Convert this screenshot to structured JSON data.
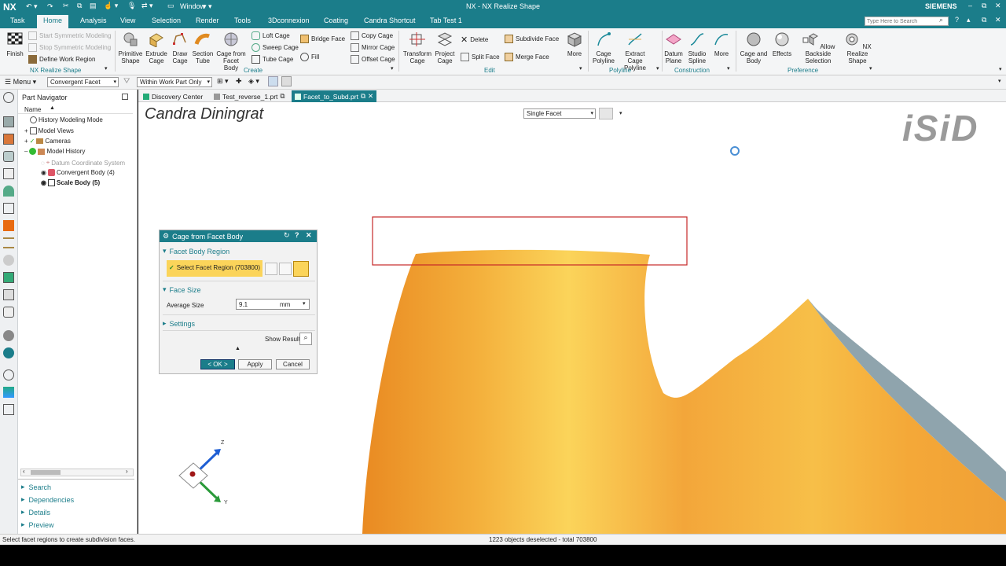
{
  "titlebar": {
    "app": "NX",
    "window_menu": "Window",
    "title": "NX - NX Realize Shape",
    "brand": "SIEMENS",
    "search_placeholder": "Type Here to Search"
  },
  "menu_tabs": [
    "Task",
    "Home",
    "Analysis",
    "View",
    "Selection",
    "Render",
    "Tools",
    "3Dconnexion",
    "Coating",
    "Candra Shortcut",
    "Tab Test 1"
  ],
  "ribbon": {
    "finish": "Finish",
    "realize_small": [
      "Start Symmetric Modeling",
      "Stop Symmetric Modeling",
      "Define Work Region"
    ],
    "realize_group": "NX Realize Shape",
    "create_big": [
      "Primitive Shape",
      "Extrude Cage",
      "Draw Cage",
      "Section Tube",
      "Cage from Facet Body"
    ],
    "create_small_a": [
      "Loft Cage",
      "Sweep Cage",
      "Tube Cage"
    ],
    "create_small_b": [
      "Bridge Face",
      "Fill"
    ],
    "create_small_c": [
      "Copy Cage",
      "Mirror Cage",
      "Offset Cage"
    ],
    "create_group": "Create",
    "edit_big": [
      "Transform Cage",
      "Project Cage"
    ],
    "edit_small_a": [
      "Delete",
      "Split Face"
    ],
    "edit_small_b": [
      "Subdivide Face",
      "Merge Face"
    ],
    "edit_more": "More",
    "edit_group": "Edit",
    "polyline_big": [
      "Cage Polyline",
      "Extract Cage Polyline"
    ],
    "polyline_group": "Polyline",
    "construction_big": [
      "Datum Plane",
      "Studio Spline",
      "More"
    ],
    "construction_group": "Construction",
    "preference_big": [
      "Cage and Body",
      "Effects",
      "Allow Backside Selection",
      "NX Realize Shape"
    ],
    "preference_group": "Preference"
  },
  "toolbar2": {
    "menu": "Menu",
    "filter": "Convergent Facet",
    "scope": "Within Work Part Only"
  },
  "navigator": {
    "title": "Part Navigator",
    "column": "Name",
    "items": [
      "History Modeling Mode",
      "Model Views",
      "Cameras",
      "Model History",
      "Datum Coordinate System",
      "Convergent Body (4)",
      "Scale Body (5)"
    ],
    "sections": [
      "Search",
      "Dependencies",
      "Details",
      "Preview"
    ]
  },
  "doc_tabs": [
    "Discovery Center",
    "Test_reverse_1.prt",
    "Facet_to_Subd.prt"
  ],
  "viewport": {
    "watermark": "Candra Diningrat",
    "logo": "iSiD",
    "facet_select": "Single Facet",
    "axis_z": "Z",
    "axis_y": "Y"
  },
  "dialog": {
    "title": "Cage from Facet Body",
    "sec1": "Facet Body Region",
    "select_label": "Select Facet Region (703800)",
    "sec2": "Face Size",
    "avg_label": "Average Size",
    "avg_value": "9.1",
    "unit": "mm",
    "sec3": "Settings",
    "show_result": "Show Result",
    "ok": "< OK >",
    "apply": "Apply",
    "cancel": "Cancel"
  },
  "status": {
    "left": "Select facet regions to create subdivision faces.",
    "center": "1223 objects deselected - total 703800"
  }
}
